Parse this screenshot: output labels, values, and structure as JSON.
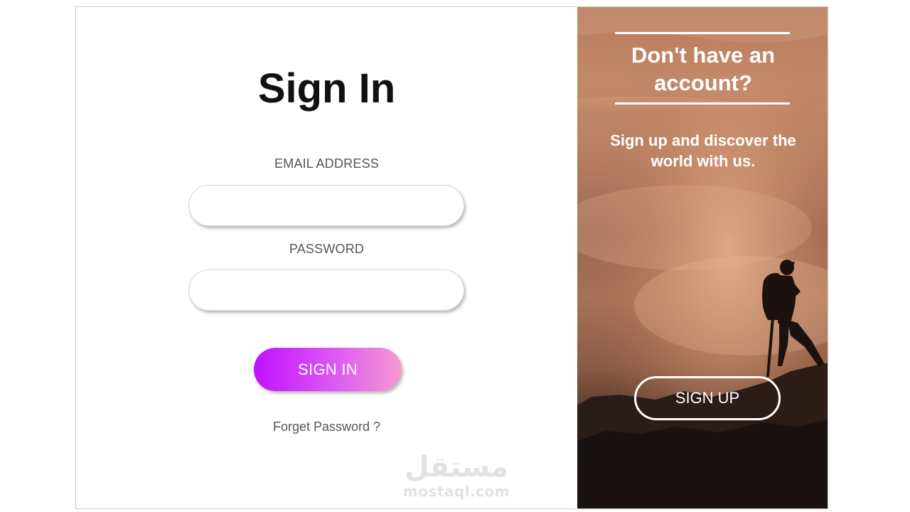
{
  "signin": {
    "title": "Sign In",
    "email_label": "EMAIL ADDRESS",
    "email_value": "",
    "password_label": "PASSWORD",
    "password_value": "",
    "submit_label": "SIGN IN",
    "forgot_label": "Forget Password ?"
  },
  "signup": {
    "heading": "Don't have an account?",
    "text": "Sign up and discover the world with us.",
    "button_label": "SIGN UP"
  },
  "watermark": {
    "logo": "مستقل",
    "domain": "mostaql.com"
  },
  "colors": {
    "signin_gradient_start": "#c010ff",
    "signin_gradient_end": "#f59ad0",
    "panel_warm": "#c28a6a"
  }
}
